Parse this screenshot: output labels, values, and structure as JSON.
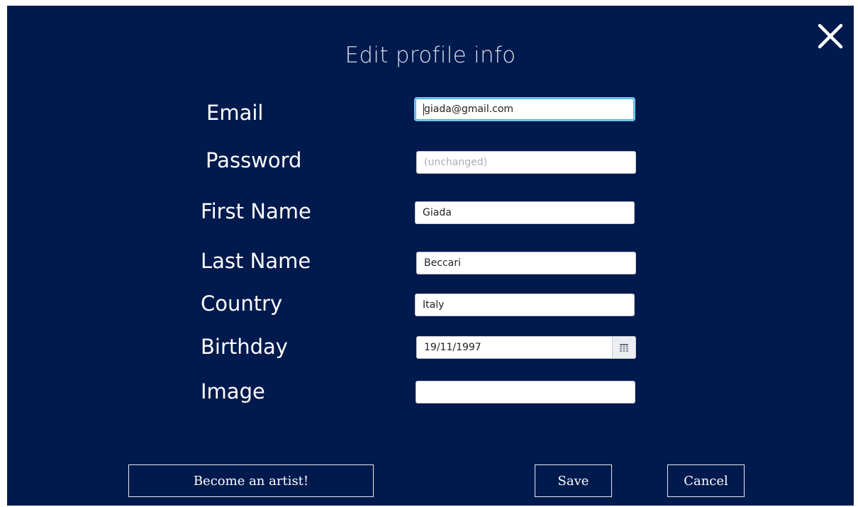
{
  "dialog": {
    "title": "Edit profile info",
    "close_icon": "close-icon"
  },
  "form": {
    "email": {
      "label": "Email",
      "value": "giada@gmail.com"
    },
    "password": {
      "label": "Password",
      "placeholder": "(unchanged)"
    },
    "first_name": {
      "label": "First Name",
      "value": "Giada"
    },
    "last_name": {
      "label": "Last Name",
      "value": "Beccari"
    },
    "country": {
      "label": "Country",
      "value": "Italy"
    },
    "birthday": {
      "label": "Birthday",
      "value": "19/11/1997",
      "icon": "calendar-icon"
    },
    "image": {
      "label": "Image",
      "value": ""
    }
  },
  "actions": {
    "become_artist_label": "Become an artist!",
    "save_label": "Save",
    "cancel_label": "Cancel"
  },
  "colors": {
    "background": "#001a4d",
    "focus_ring": "#5fb7ea",
    "text": "#ffffff"
  }
}
